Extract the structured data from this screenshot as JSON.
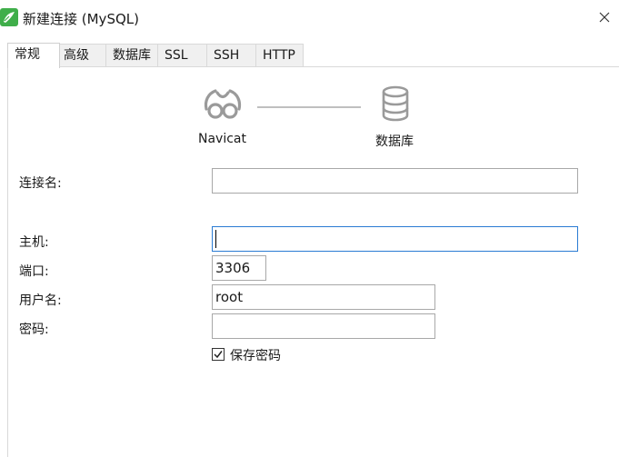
{
  "window": {
    "title": "新建连接 (MySQL)",
    "app_icon": "navicat-app-icon",
    "accent": "#3fae4a"
  },
  "tabs": [
    {
      "label": "常规",
      "active": true
    },
    {
      "label": "高级",
      "active": false
    },
    {
      "label": "数据库",
      "active": false
    },
    {
      "label": "SSL",
      "active": false
    },
    {
      "label": "SSH",
      "active": false
    },
    {
      "label": "HTTP",
      "active": false
    }
  ],
  "diagram": {
    "left_label": "Navicat",
    "right_label": "数据库",
    "left_icon": "navicat-logo-icon",
    "right_icon": "database-icon"
  },
  "form": {
    "connection_name": {
      "label": "连接名:",
      "value": ""
    },
    "host": {
      "label": "主机:",
      "value": ""
    },
    "port": {
      "label": "端口:",
      "value": "3306"
    },
    "username": {
      "label": "用户名:",
      "value": "root"
    },
    "password": {
      "label": "密码:",
      "value": ""
    },
    "save_password": {
      "label": "保存密码",
      "checked": true
    }
  }
}
